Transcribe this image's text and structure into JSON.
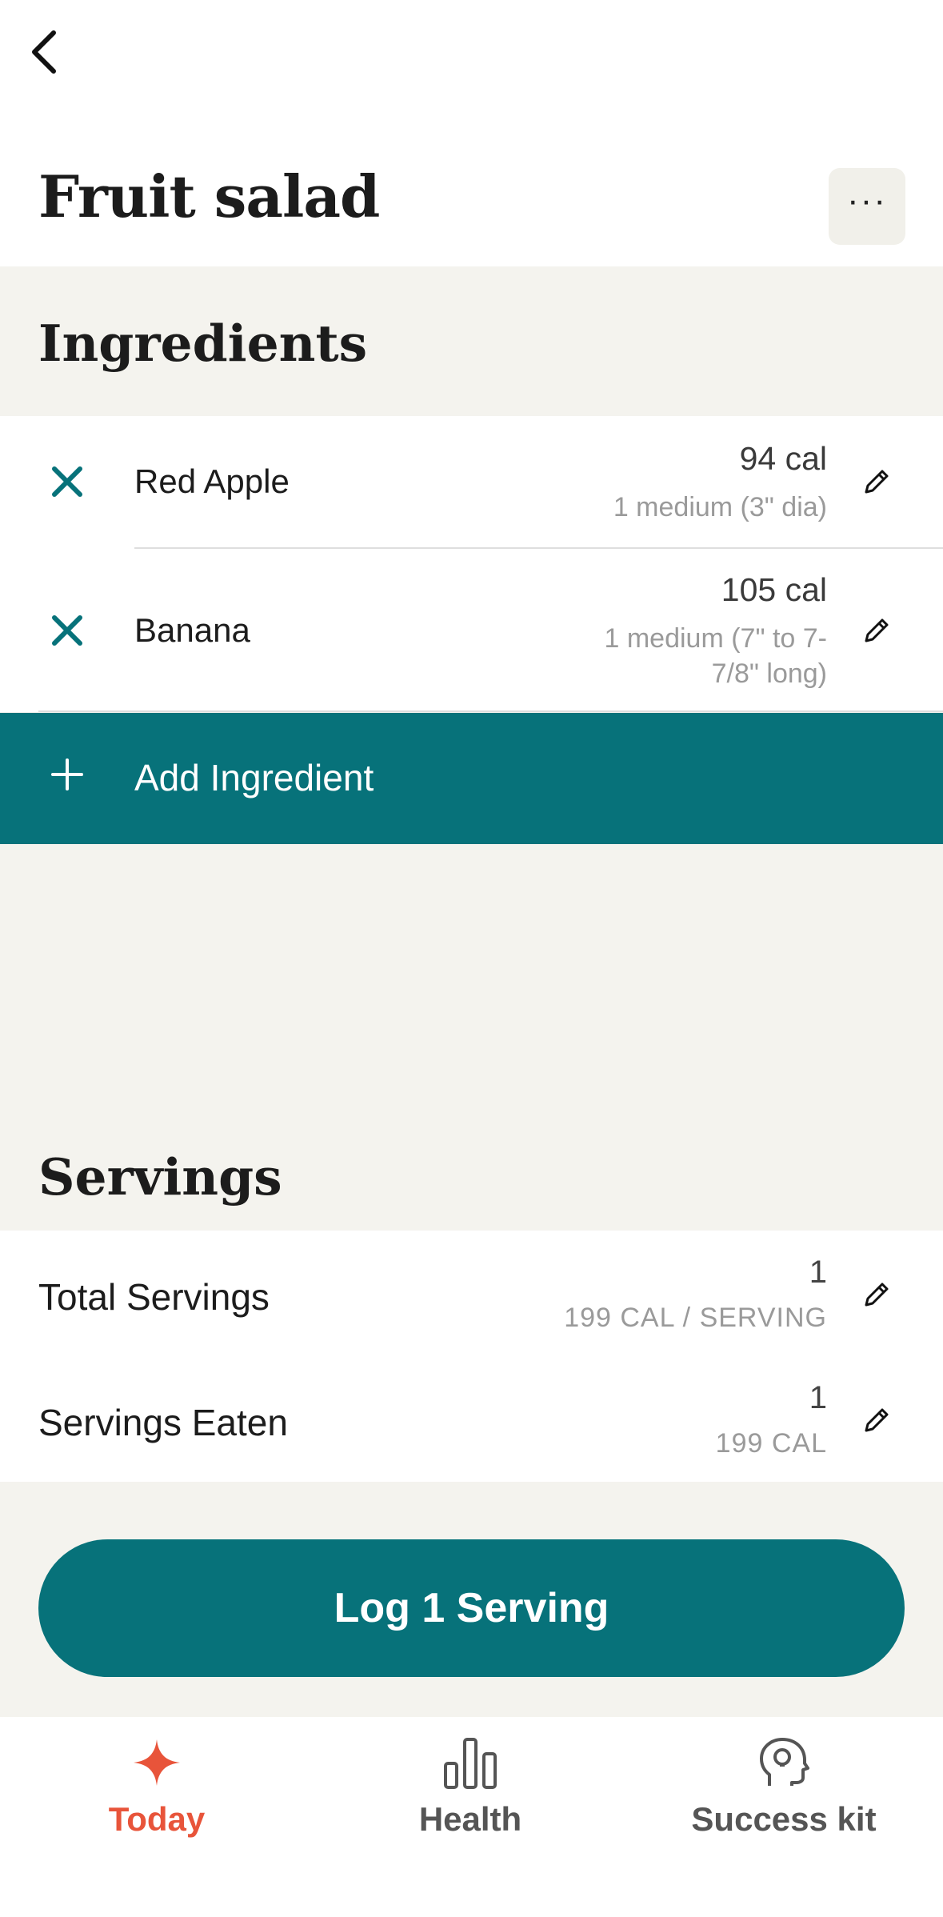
{
  "header": {
    "title": "Fruit salad",
    "more_label": "···"
  },
  "ingredients": {
    "title": "Ingredients",
    "items": [
      {
        "name": "Red Apple",
        "calories": "94 cal",
        "portion": "1 medium (3\" dia)"
      },
      {
        "name": "Banana",
        "calories": "105 cal",
        "portion": "1 medium (7\" to 7-7/8\" long)"
      }
    ],
    "add_label": "Add Ingredient"
  },
  "servings": {
    "title": "Servings",
    "total": {
      "label": "Total Servings",
      "value": "1",
      "sub": "199 CAL / SERVING"
    },
    "eaten": {
      "label": "Servings Eaten",
      "value": "1",
      "sub": "199 CAL"
    }
  },
  "log_button": "Log 1 Serving",
  "tabs": [
    {
      "label": "Today",
      "icon": "sparkle-icon",
      "active": true
    },
    {
      "label": "Health",
      "icon": "bar-chart-icon",
      "active": false
    },
    {
      "label": "Success kit",
      "icon": "head-lightbulb-icon",
      "active": false
    }
  ],
  "colors": {
    "primary": "#07727a",
    "accent": "#e8543a",
    "background": "#f4f3ee"
  }
}
